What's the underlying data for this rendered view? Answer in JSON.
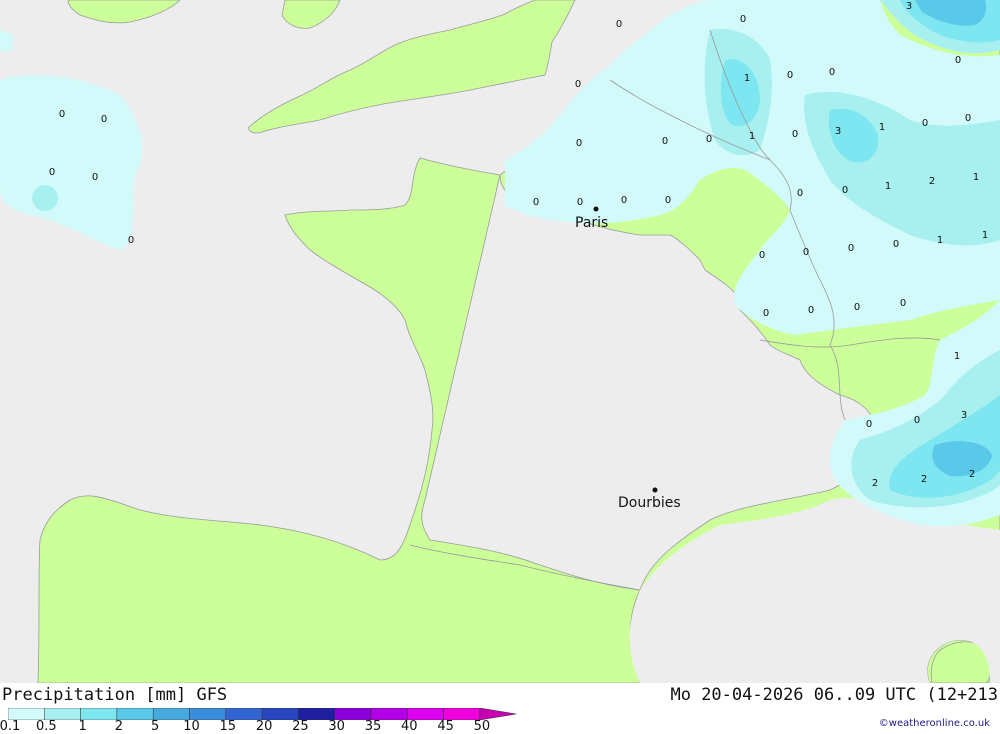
{
  "map": {
    "colors": {
      "sea": "#ededed",
      "land": "#ccff99",
      "border": "#9a9a9a",
      "precip_0_1": "#d2fafa",
      "precip_0_5": "#a8f0f0",
      "precip_1": "#7de6f0",
      "precip_2": "#5ac8e8"
    },
    "cities": [
      {
        "name": "Paris"
      },
      {
        "name": "Dourbies"
      }
    ],
    "values": [
      "0",
      "0",
      "0",
      "0",
      "0",
      "0",
      "0",
      "0",
      "0",
      "0",
      "0",
      "0",
      "0",
      "0",
      "0",
      "0",
      "0",
      "0",
      "0",
      "0",
      "0",
      "0",
      "0",
      "0",
      "0",
      "0",
      "0",
      "0",
      "0",
      "0",
      "0",
      "0",
      "0",
      "0",
      "0",
      "0",
      "0",
      "0",
      "1",
      "1",
      "1",
      "1",
      "1",
      "1",
      "1",
      "1",
      "2",
      "2",
      "2",
      "2",
      "3",
      "3",
      "3"
    ]
  },
  "legend": {
    "title": "Precipitation [mm] GFS",
    "ticks": [
      "0.1",
      "0.5",
      "1",
      "2",
      "5",
      "10",
      "15",
      "20",
      "25",
      "30",
      "35",
      "40",
      "45",
      "50"
    ],
    "colors": [
      "#d2fafa",
      "#a8f0f0",
      "#7de6f0",
      "#5ac8e8",
      "#46aae0",
      "#3c8cdc",
      "#3264d2",
      "#2846be",
      "#1e1ea0",
      "#8c00dc",
      "#b400e6",
      "#dc00f0",
      "#f000dc",
      "#c800b4"
    ]
  },
  "valid_time": "Mo 20-04-2026 06..09 UTC (12+213",
  "credit": "©weatheronline.co.uk"
}
